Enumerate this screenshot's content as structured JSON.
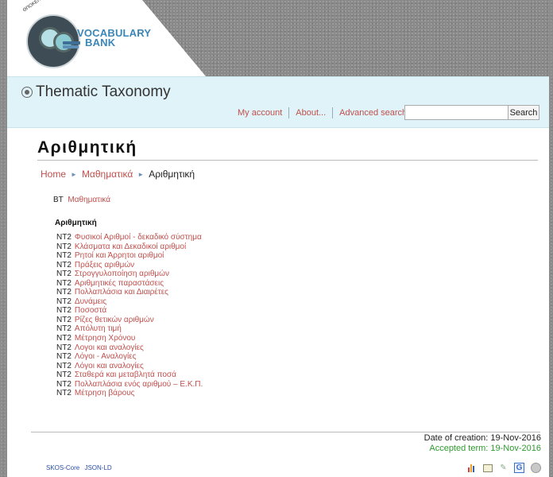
{
  "logo": {
    "text_line1": "VOCABULARY",
    "text_line2": "BANK",
    "arc_text": "ΘΠΟΚΕΙΤΟ"
  },
  "header": {
    "title": "Thematic Taxonomy"
  },
  "topnav": {
    "my_account": "My account",
    "about": "About...",
    "advanced_search": "Advanced search"
  },
  "search": {
    "value": "",
    "button_label": "Search"
  },
  "page": {
    "heading": "Αριθμητική"
  },
  "breadcrumb": {
    "home": "Home",
    "parent": "Μαθηματικά",
    "current": "Αριθμητική"
  },
  "broader": {
    "tag": "BT",
    "term": "Μαθηματικά"
  },
  "narrower": {
    "label": "Αριθμητική",
    "tag": "NT2",
    "items": [
      "Φυσικοί Αριθμοί - δεκαδικό σύστημα",
      "Κλάσματα και Δεκαδικοί αριθμοί",
      "Ρητοί και Άρρητοι αριθμοί",
      "Πράξεις αριθμών",
      "Στρογγυλοποίηση αριθμών",
      "Αριθμητικές παραστάσεις",
      "Πολλαπλάσια και Διαιρέτες",
      "Δυνάμεις",
      "Ποσοστά",
      "Ρίζες θετικών αριθμών",
      "Απόλυτη τιμή",
      "Μέτρηση Χρόνου",
      "Λογοι και αναλογίες",
      "Λόγοι - Αναλογίες",
      "Λόγοι και αναλογίες",
      "Σταθερά και μεταβλητά ποσά",
      "Πολλαπλάσια ενός αριθμού – Ε.Κ.Π.",
      "Μέτρηση βάρους"
    ]
  },
  "footer": {
    "date_created": "Date of creation: 19-Nov-2016",
    "accepted": "Accepted term: 19-Nov-2016",
    "skos": "SKOS-Core",
    "jsonld": "JSON-LD",
    "icons": [
      "stats-icon",
      "export-icon",
      "tool-icon",
      "google-icon",
      "moon-icon"
    ]
  }
}
